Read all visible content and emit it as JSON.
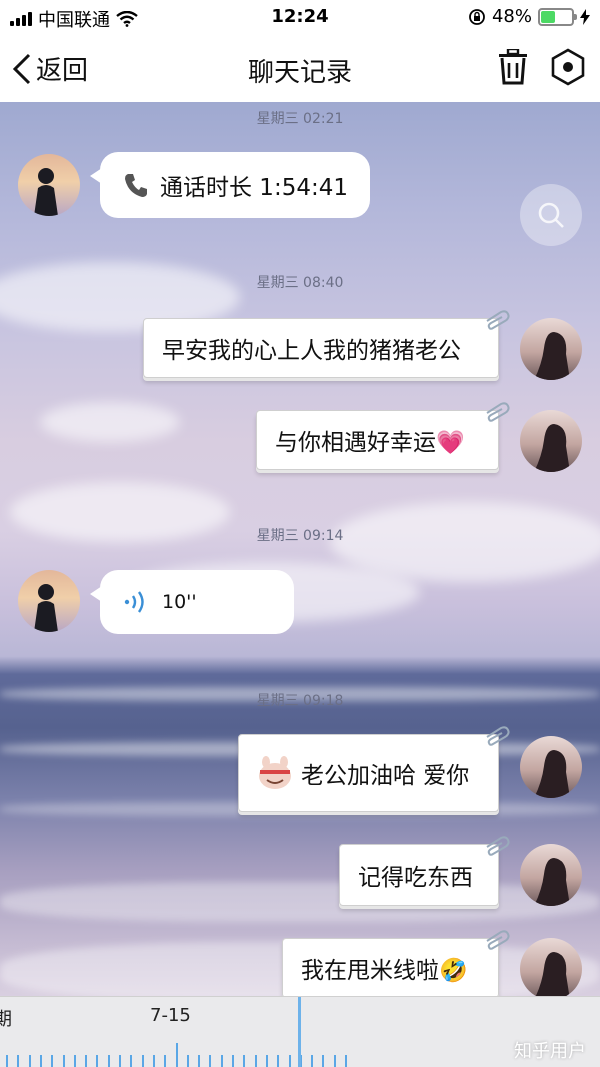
{
  "status_bar": {
    "carrier": "中国联通",
    "time": "12:24",
    "battery": "48%",
    "battery_level": 0.48
  },
  "navbar": {
    "back_label": "返回",
    "title": "聊天记录"
  },
  "messages": [
    {
      "timestamp": "星期三 02:21",
      "text": "通话时长 1:54:41"
    },
    {
      "timestamp": "星期三 08:40",
      "text": "早安我的心上人我的猪猪老公"
    },
    {
      "text": "与你相遇好幸运💗"
    },
    {
      "timestamp": "星期三 09:14",
      "text": "10''"
    },
    {
      "timestamp": "星期三 09:18",
      "text": "老公加油哈 爱你"
    },
    {
      "text": "记得吃东西"
    },
    {
      "text": "我在甩米线啦🤣"
    }
  ],
  "timeline": {
    "left_label": "期",
    "date_label": "7-15"
  },
  "watermark": "知乎用户",
  "colors": {
    "accent": "#5aa7e6",
    "battery": "#4cd964",
    "timestamp_text": "#6b6f86"
  }
}
